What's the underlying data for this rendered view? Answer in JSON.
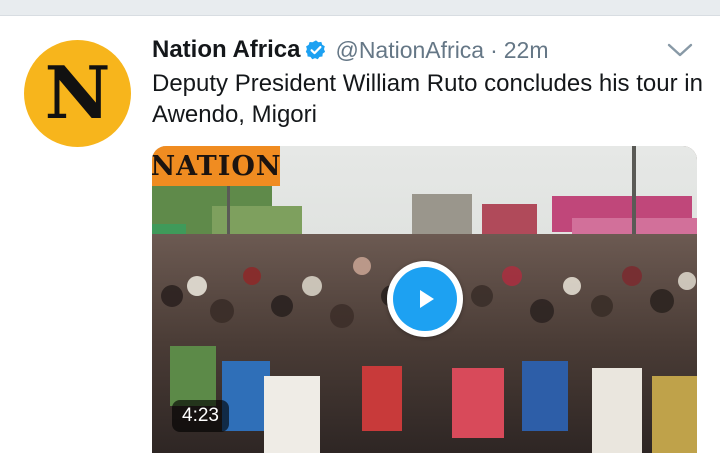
{
  "tweet": {
    "avatar_letter": "N",
    "display_name": "Nation Africa",
    "handle": "@NationAfrica",
    "separator": "·",
    "time": "22m",
    "text": "Deputy President William Ruto concludes his tour in Awendo, Migori"
  },
  "media": {
    "logo_text": "NATION",
    "duration": "4:23",
    "play_icon": "play-icon"
  },
  "colors": {
    "avatar_bg": "#f7b51c",
    "verified_blue": "#1da1f2",
    "nation_orange": "#f08c21",
    "meta_gray": "#657786"
  }
}
